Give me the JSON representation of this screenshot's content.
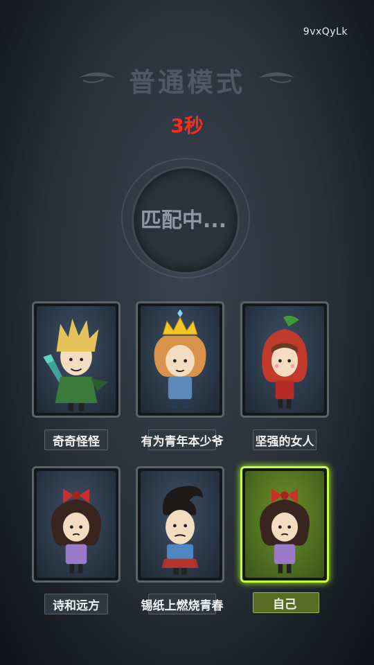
{
  "room_code": "9vxQyLk",
  "mode_title": "普通模式",
  "countdown": "3秒",
  "matching_text": "匹配中...",
  "players": [
    {
      "name": "奇奇怪怪",
      "character": "blonde-swordsman-avatar",
      "is_self": false
    },
    {
      "name": "有为青年本少爷",
      "character": "crowned-boy-avatar",
      "is_self": false
    },
    {
      "name": "坚强的女人",
      "character": "red-hood-girl-avatar",
      "is_self": false
    },
    {
      "name": "诗和远方",
      "character": "bow-girl-avatar",
      "is_self": false
    },
    {
      "name": "锡纸上燃烧青春",
      "character": "pompadour-man-avatar",
      "is_self": false
    },
    {
      "name": "自己",
      "character": "bow-girl-avatar",
      "is_self": true
    }
  ],
  "colors": {
    "countdown": "#ff2a1a",
    "self_highlight": "#c9ff3a"
  }
}
